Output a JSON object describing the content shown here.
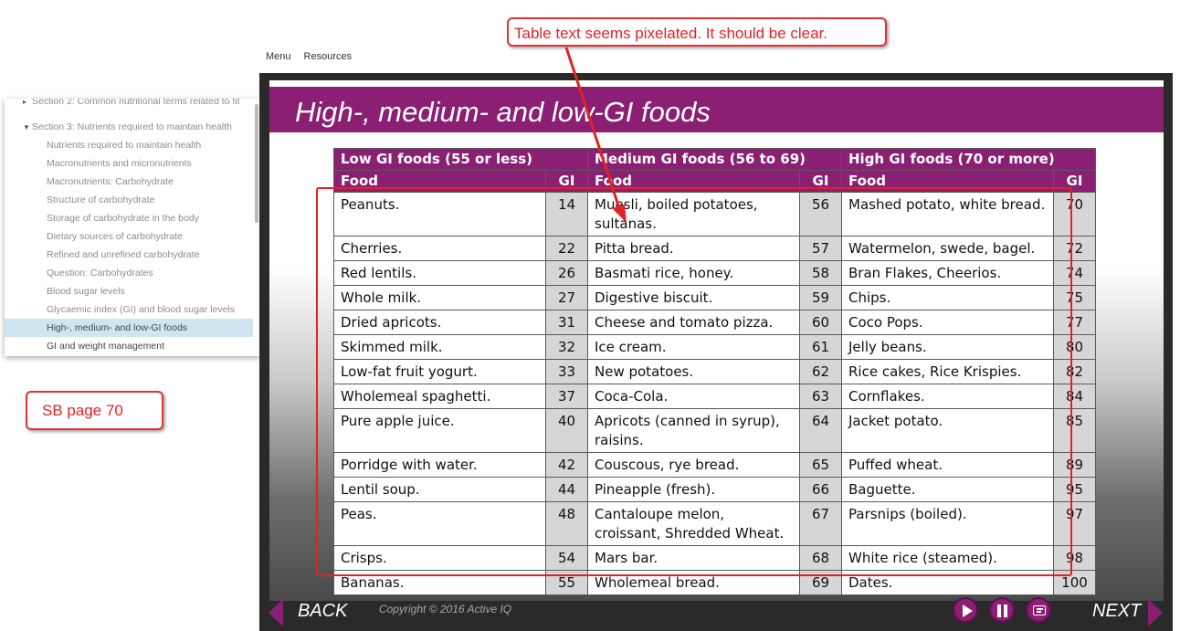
{
  "topmenu": {
    "menu": "Menu",
    "resources": "Resources"
  },
  "sidebar": {
    "cut_row": "Section 2: Common nutritional terms related to fit",
    "section": "Section 3: Nutrients required to maintain health",
    "items": [
      "Nutrients required to maintain health",
      "Macronutrients and micronutrients",
      "Macronutrients: Carbohydrate",
      "Structure of carbohydrate",
      "Storage of carbohydrate in the body",
      "Dietary sources of carbohydrate",
      "Refined and unrefined carbohydrate",
      "Question: Carbohydrates",
      "Blood sugar levels",
      "Glycaemic index (GI) and blood sugar levels",
      "High-, medium- and low-GI foods",
      "GI and weight management"
    ],
    "active_index": 10
  },
  "slide": {
    "title": "High-, medium- and low-GI foods",
    "table": {
      "group_headers": [
        "Low GI foods (55 or less)",
        "Medium GI foods (56 to 69)",
        "High GI foods (70 or more)"
      ],
      "col_food": "Food",
      "col_gi": "GI",
      "rows": [
        [
          [
            "Peanuts.",
            "14"
          ],
          [
            "Muesli, boiled potatoes, sultanas.",
            "56"
          ],
          [
            "Mashed potato, white bread.",
            "70"
          ]
        ],
        [
          [
            "Cherries.",
            "22"
          ],
          [
            "Pitta bread.",
            "57"
          ],
          [
            "Watermelon, swede, bagel.",
            "72"
          ]
        ],
        [
          [
            "Red lentils.",
            "26"
          ],
          [
            "Basmati rice, honey.",
            "58"
          ],
          [
            "Bran Flakes, Cheerios.",
            "74"
          ]
        ],
        [
          [
            "Whole milk.",
            "27"
          ],
          [
            "Digestive biscuit.",
            "59"
          ],
          [
            "Chips.",
            "75"
          ]
        ],
        [
          [
            "Dried apricots.",
            "31"
          ],
          [
            "Cheese and tomato pizza.",
            "60"
          ],
          [
            "Coco Pops.",
            "77"
          ]
        ],
        [
          [
            "Skimmed milk.",
            "32"
          ],
          [
            "Ice cream.",
            "61"
          ],
          [
            "Jelly beans.",
            "80"
          ]
        ],
        [
          [
            "Low-fat fruit yogurt.",
            "33"
          ],
          [
            "New potatoes.",
            "62"
          ],
          [
            "Rice cakes, Rice Krispies.",
            "82"
          ]
        ],
        [
          [
            "Wholemeal spaghetti.",
            "37"
          ],
          [
            "Coca-Cola.",
            "63"
          ],
          [
            "Cornflakes.",
            "84"
          ]
        ],
        [
          [
            "Pure apple juice.",
            "40"
          ],
          [
            "Apricots (canned in syrup), raisins.",
            "64"
          ],
          [
            "Jacket potato.",
            "85"
          ]
        ],
        [
          [
            "Porridge with water.",
            "42"
          ],
          [
            "Couscous, rye bread.",
            "65"
          ],
          [
            "Puffed wheat.",
            "89"
          ]
        ],
        [
          [
            "Lentil soup.",
            "44"
          ],
          [
            "Pineapple (fresh).",
            "66"
          ],
          [
            "Baguette.",
            "95"
          ]
        ],
        [
          [
            "Peas.",
            "48"
          ],
          [
            "Cantaloupe melon, croissant, Shredded Wheat.",
            "67"
          ],
          [
            "Parsnips (boiled).",
            "97"
          ]
        ],
        [
          [
            "Crisps.",
            "54"
          ],
          [
            "Mars bar.",
            "68"
          ],
          [
            "White rice (steamed).",
            "98"
          ]
        ],
        [
          [
            "Bananas.",
            "55"
          ],
          [
            "Wholemeal bread.",
            "69"
          ],
          [
            "Dates.",
            "100"
          ]
        ]
      ]
    }
  },
  "player": {
    "back": "BACK",
    "next": "NEXT",
    "copyright": "Copyright © 2016 Active IQ",
    "play_icon": "play-icon",
    "pause_icon": "pause-icon",
    "caption_icon": "closed-caption-icon"
  },
  "annotations": {
    "top": "Table text seems pixelated. It should be clear.",
    "left": "SB page 70"
  },
  "colors": {
    "accent": "#8a1f74",
    "annotation": "#e02424",
    "sidebar_active": "#cfe6f2"
  }
}
